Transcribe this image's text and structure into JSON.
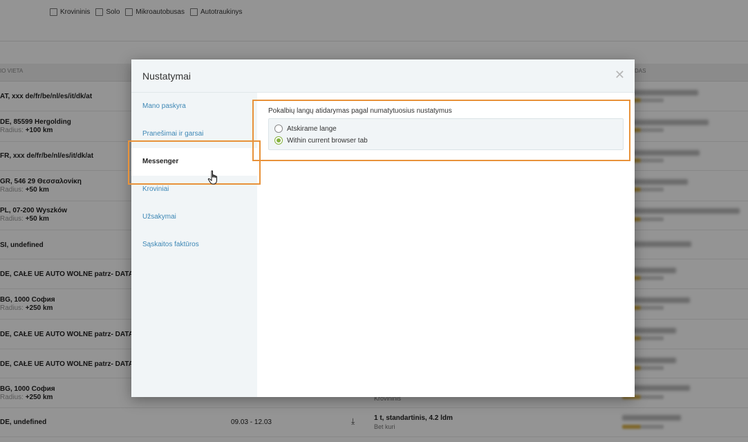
{
  "filters": [
    {
      "label": "Krovininis"
    },
    {
      "label": "Solo"
    },
    {
      "label": "Mikroautobusas"
    },
    {
      "label": "Autotraukinys"
    }
  ],
  "table_header": {
    "left": "IO VIETA",
    "right": "DAS"
  },
  "rows": [
    {
      "loc": "AT, xxx de/fr/be/nl/es/it/dk/at",
      "radius_label": "",
      "radius": "",
      "date": "",
      "cargo": "",
      "cargo_sub": ""
    },
    {
      "loc": "DE, 85599 Hergolding",
      "radius_label": "Radius:",
      "radius": "+100 km",
      "date": "",
      "cargo": "",
      "cargo_sub": ""
    },
    {
      "loc": "FR, xxx de/fr/be/nl/es/it/dk/at",
      "radius_label": "",
      "radius": "",
      "date": "",
      "cargo": "",
      "cargo_sub": ""
    },
    {
      "loc": "GR, 546 29 Θεσσαλονίκη",
      "radius_label": "Radius:",
      "radius": "+50 km",
      "date": "",
      "cargo": "",
      "cargo_sub": ""
    },
    {
      "loc": "PL, 07-200 Wyszków",
      "radius_label": "Radius:",
      "radius": "+50 km",
      "date": "",
      "cargo": "",
      "cargo_sub": ""
    },
    {
      "loc": "SI, undefined",
      "radius_label": "",
      "radius": "",
      "date": "",
      "cargo": "",
      "cargo_sub": ""
    },
    {
      "loc": "DE, CAŁE UE AUTO WOLNE patrz- DATA",
      "radius_label": "",
      "radius": "",
      "date": "",
      "cargo": "",
      "cargo_sub": ""
    },
    {
      "loc": "BG, 1000 София",
      "radius_label": "Radius:",
      "radius": "+250 km",
      "date": "",
      "cargo": "",
      "cargo_sub": ""
    },
    {
      "loc": "DE, CAŁE UE AUTO WOLNE patrz- DATA",
      "radius_label": "",
      "radius": "",
      "date": "",
      "cargo": "",
      "cargo_sub": ""
    },
    {
      "loc": "DE, CAŁE UE AUTO WOLNE patrz- DATA",
      "radius_label": "",
      "radius": "",
      "date": "",
      "cargo": "",
      "cargo_sub": ""
    },
    {
      "loc": "BG, 1000 София",
      "radius_label": "Radius:",
      "radius": "+250 km",
      "date": "",
      "cargo": "",
      "cargo_sub": "Krovininis"
    },
    {
      "loc": "DE, undefined",
      "radius_label": "",
      "radius": "",
      "date": "09.03 - 12.03",
      "cargo": "1 t, standartinis, 4.2 ldm",
      "cargo_sub": "Bet kuri"
    }
  ],
  "modal": {
    "title": "Nustatymai",
    "close_icon": "close-icon",
    "sidebar": [
      {
        "label": "Mano paskyra",
        "active": false
      },
      {
        "label": "Pranešimai ir garsai",
        "active": false
      },
      {
        "label": "Messenger",
        "active": true
      },
      {
        "label": "Kroviniai",
        "active": false
      },
      {
        "label": "Užsakymai",
        "active": false
      },
      {
        "label": "Sąskaitos faktūros",
        "active": false
      }
    ],
    "content": {
      "setting_title": "Pokalbių langų atidarymas pagal numatytuosius nustatymus",
      "options": [
        {
          "label": "Atskirame lange",
          "checked": false
        },
        {
          "label": "Within current browser tab",
          "checked": true
        }
      ]
    }
  },
  "colors": {
    "accent_link": "#3d87b5",
    "radio_checked": "#86b23f",
    "highlight": "#e8923a"
  }
}
